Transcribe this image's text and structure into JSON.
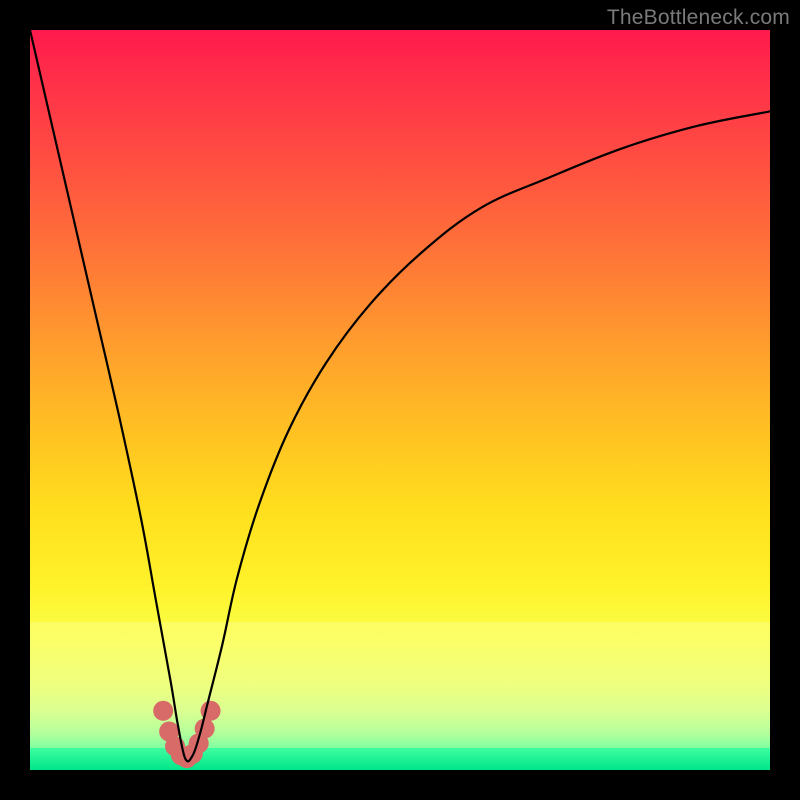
{
  "watermark": "TheBottleneck.com",
  "band_top_frac": 0.8,
  "band_bottom_frac": 0.97,
  "chart_data": {
    "type": "line",
    "title": "",
    "xlabel": "",
    "ylabel": "",
    "xlim": [
      0,
      100
    ],
    "ylim": [
      0,
      100
    ],
    "legend": false,
    "grid": false,
    "background": "rainbow-vertical-gradient (red top → green bottom)",
    "annotations": [
      "Salmon marker blob at curve minimum near x≈21, y≈2–8"
    ],
    "series": [
      {
        "name": "bottleneck-curve",
        "x": [
          0,
          3,
          6,
          9,
          12,
          15,
          17,
          19,
          20,
          21,
          22,
          23,
          24,
          26,
          28,
          31,
          35,
          40,
          46,
          53,
          61,
          70,
          80,
          90,
          100
        ],
        "y": [
          100,
          87,
          74,
          61,
          48,
          34,
          23,
          12,
          6,
          1.5,
          2,
          5,
          9,
          17,
          26,
          36,
          46,
          55,
          63,
          70,
          76,
          80,
          84,
          87,
          89
        ]
      }
    ],
    "marker_cluster": {
      "color": "#d86a68",
      "points": [
        {
          "x": 18.0,
          "y": 8.0
        },
        {
          "x": 18.8,
          "y": 5.2
        },
        {
          "x": 19.6,
          "y": 3.2
        },
        {
          "x": 20.4,
          "y": 2.0
        },
        {
          "x": 21.2,
          "y": 1.6
        },
        {
          "x": 22.0,
          "y": 2.2
        },
        {
          "x": 22.8,
          "y": 3.6
        },
        {
          "x": 23.6,
          "y": 5.6
        },
        {
          "x": 24.4,
          "y": 8.0
        }
      ],
      "radius_px": 10
    }
  }
}
